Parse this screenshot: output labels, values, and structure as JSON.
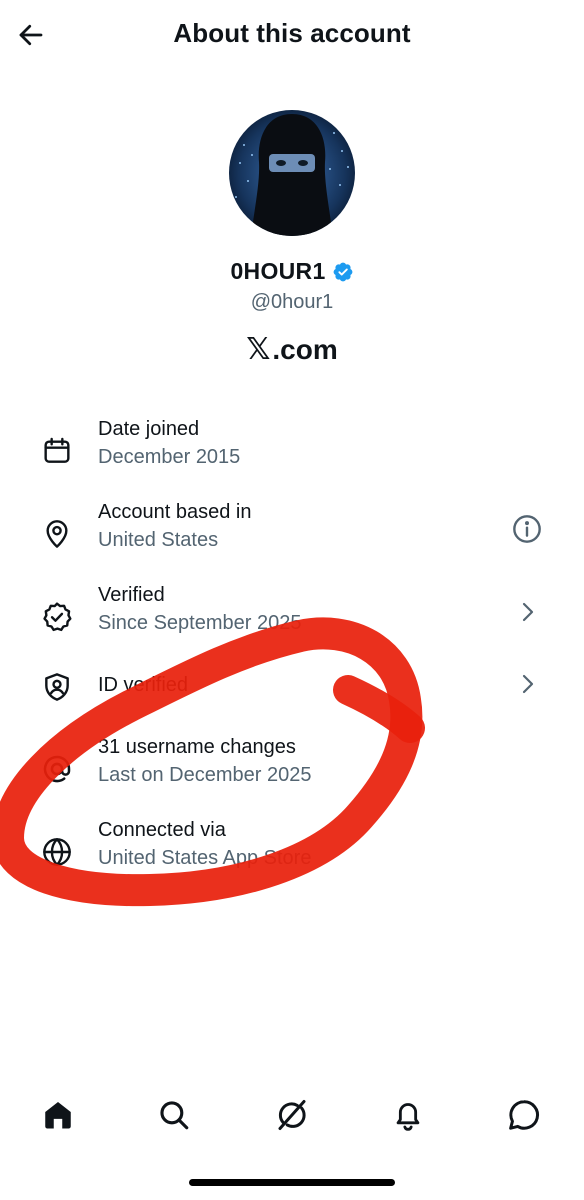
{
  "header": {
    "title": "About this account",
    "back_icon": "arrow-left-icon"
  },
  "profile": {
    "display_name": "0HOUR1",
    "handle": "@0hour1",
    "verified_badge_color": "#1d9bf0",
    "site_logo": "𝕏",
    "site_suffix": ".com"
  },
  "info": [
    {
      "icon": "calendar-icon",
      "title": "Date joined",
      "subtitle": "December 2015"
    },
    {
      "icon": "location-pin-icon",
      "title": "Account based in",
      "subtitle": "United States",
      "action_icon": "info-circle-icon"
    },
    {
      "icon": "verified-seal-icon",
      "title": "Verified",
      "subtitle": "Since September 2025",
      "action_icon": "chevron-right-icon"
    },
    {
      "icon": "id-shield-icon",
      "title": "ID verified",
      "action_icon": "chevron-right-icon"
    },
    {
      "icon": "at-sign-icon",
      "title": "31 username changes",
      "subtitle": "Last on December 2025"
    },
    {
      "icon": "globe-icon",
      "title": "Connected via",
      "subtitle": "United States App Store"
    }
  ],
  "annotation": {
    "color": "#e8200c"
  },
  "tabbar": {
    "tabs": [
      "home-icon",
      "search-icon",
      "grok-icon",
      "bell-icon",
      "messages-icon"
    ]
  },
  "colors": {
    "text": "#0f1419",
    "secondary": "#536471",
    "accent": "#1d9bf0"
  }
}
